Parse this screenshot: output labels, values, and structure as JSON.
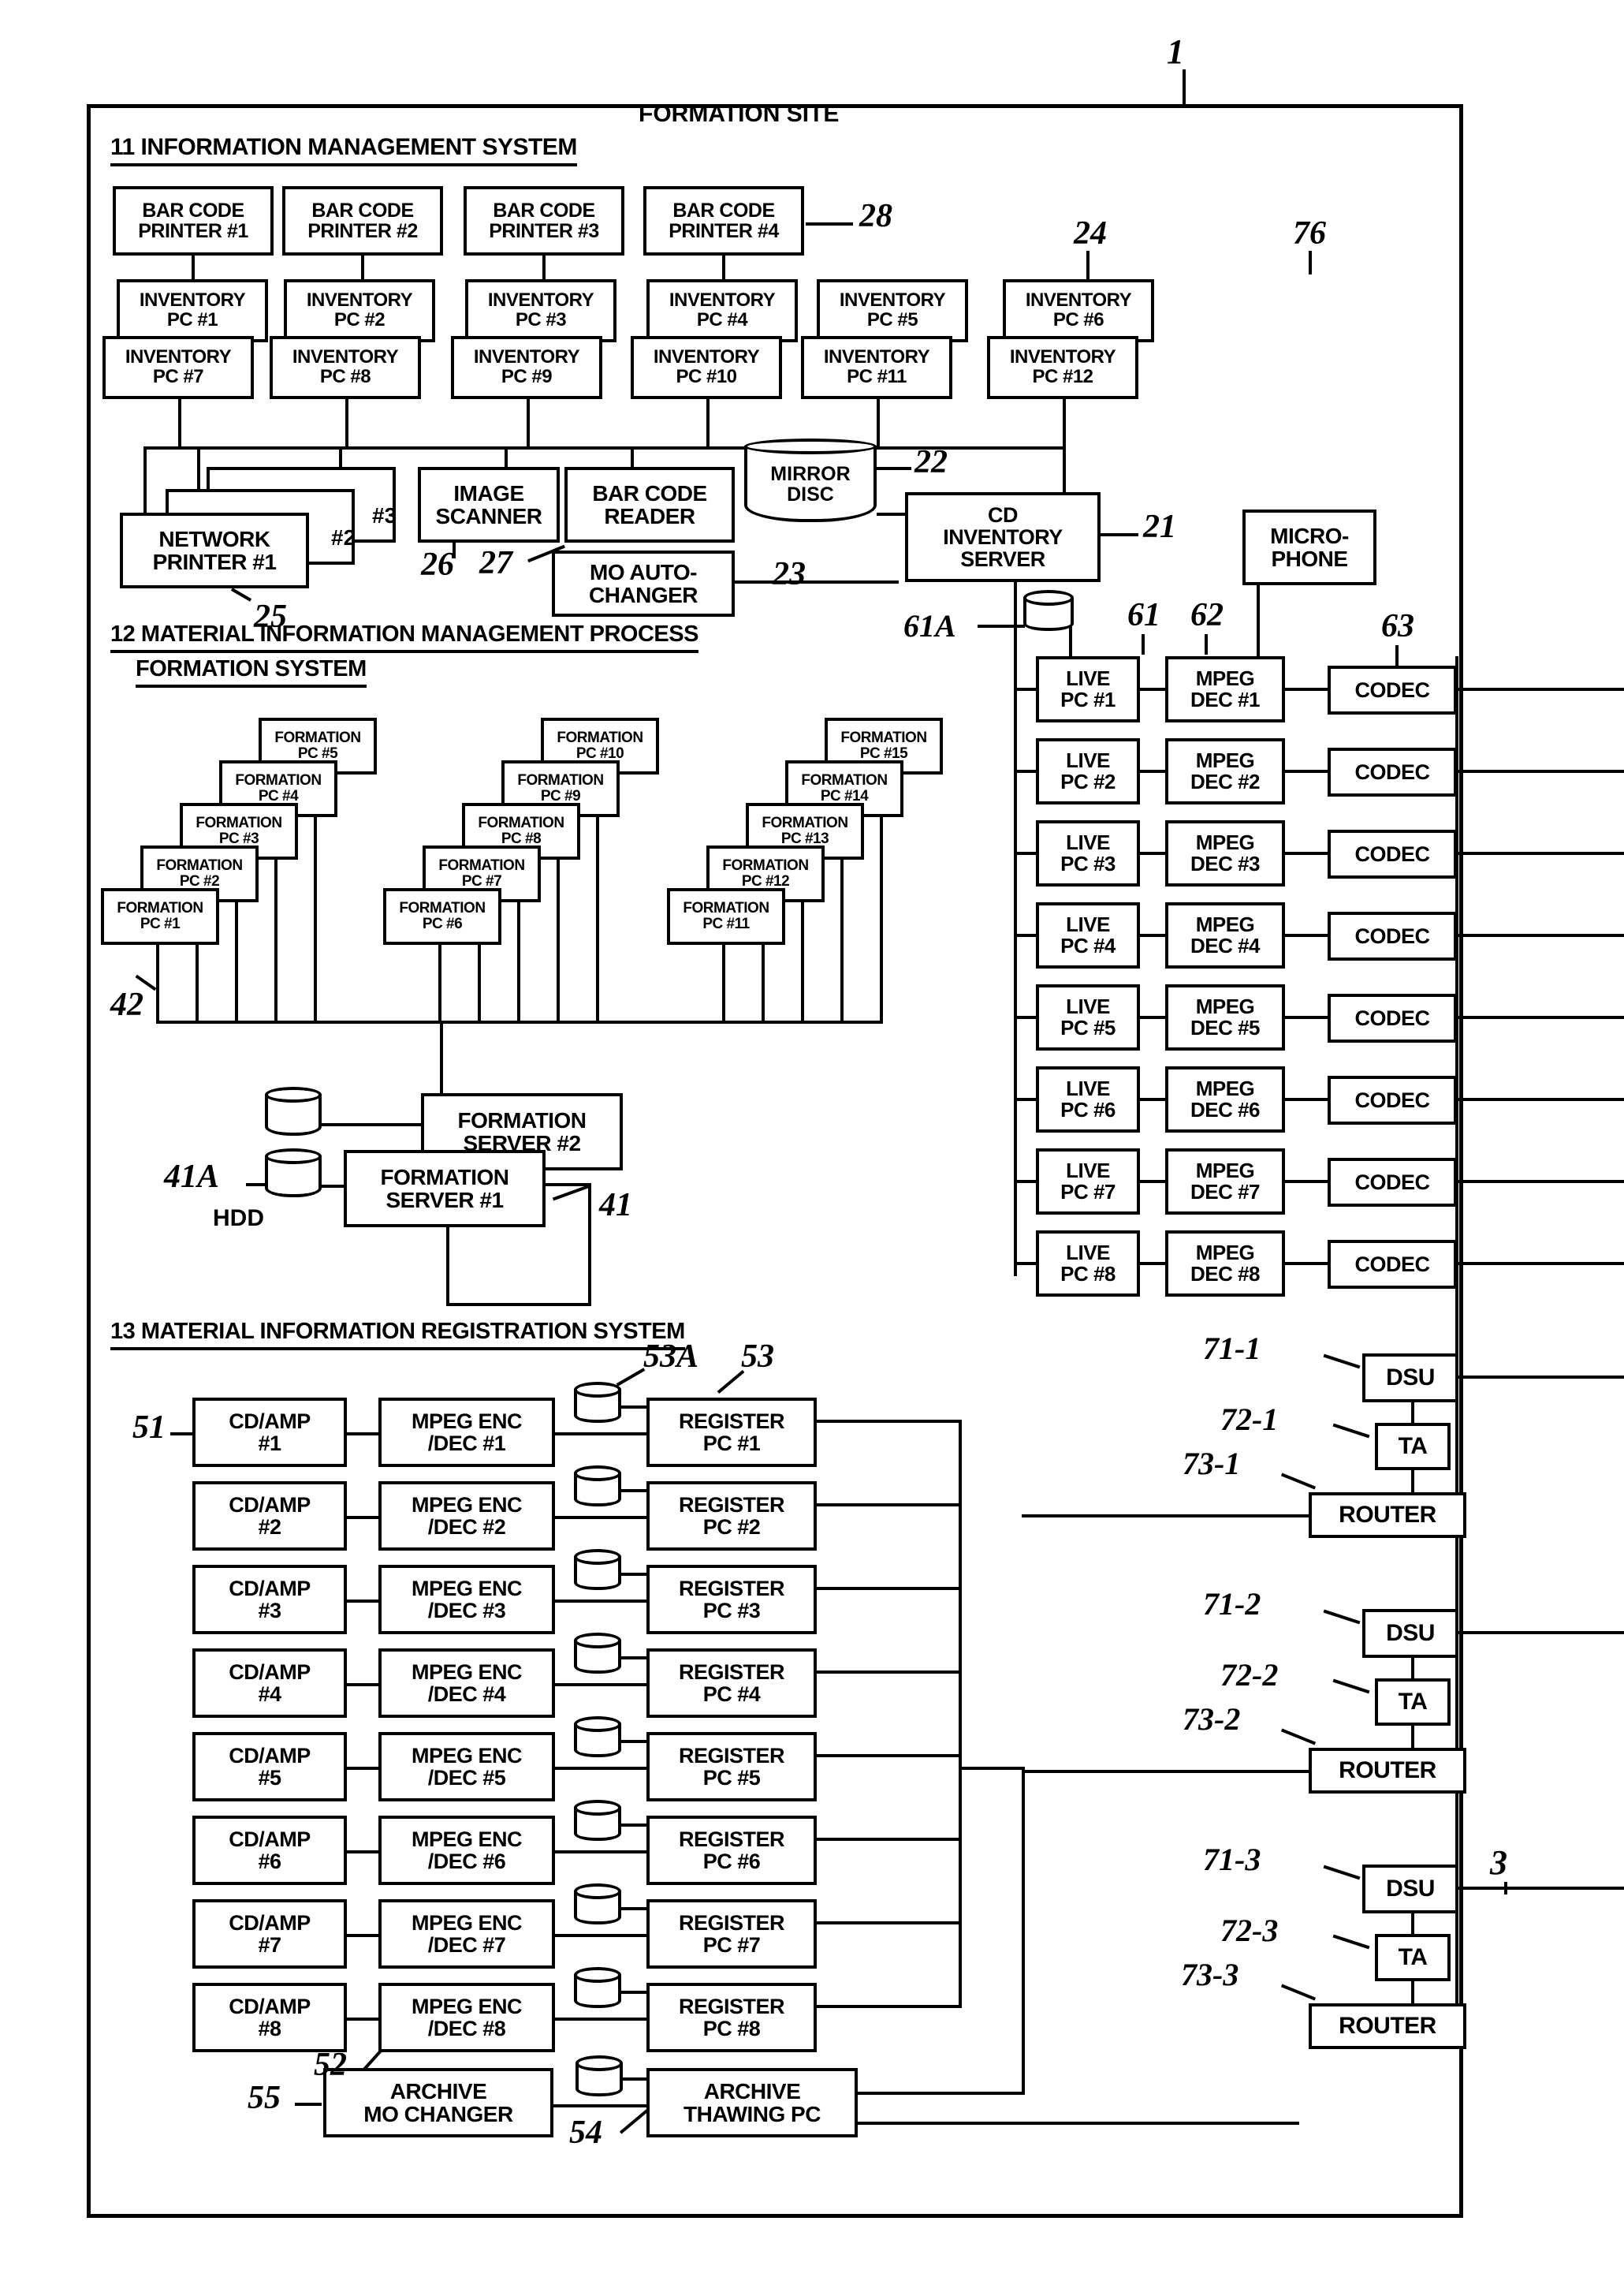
{
  "figure": {
    "site_title": "FORMATION SITE",
    "outer_ref": "1",
    "right_ref": "3"
  },
  "sections": {
    "s11": "11 INFORMATION MANAGEMENT SYSTEM",
    "s12_line1": "12 MATERIAL INFORMATION MANAGEMENT PROCESS",
    "s12_line2": "FORMATION SYSTEM",
    "s13": "13 MATERIAL INFORMATION REGISTRATION SYSTEM"
  },
  "bar_code_printers": [
    {
      "l1": "BAR CODE",
      "l2": "PRINTER #1"
    },
    {
      "l1": "BAR CODE",
      "l2": "PRINTER #2"
    },
    {
      "l1": "BAR CODE",
      "l2": "PRINTER #3"
    },
    {
      "l1": "BAR CODE",
      "l2": "PRINTER #4"
    }
  ],
  "inventory_pcs_top": [
    {
      "l1": "INVENTORY",
      "l2": "PC #1"
    },
    {
      "l1": "INVENTORY",
      "l2": "PC #2"
    },
    {
      "l1": "INVENTORY",
      "l2": "PC #3"
    },
    {
      "l1": "INVENTORY",
      "l2": "PC #4"
    },
    {
      "l1": "INVENTORY",
      "l2": "PC #5"
    },
    {
      "l1": "INVENTORY",
      "l2": "PC #6"
    }
  ],
  "inventory_pcs_bottom": [
    {
      "l1": "INVENTORY",
      "l2": "PC #7"
    },
    {
      "l1": "INVENTORY",
      "l2": "PC #8"
    },
    {
      "l1": "INVENTORY",
      "l2": "PC #9"
    },
    {
      "l1": "INVENTORY",
      "l2": "PC #10"
    },
    {
      "l1": "INVENTORY",
      "l2": "PC #11"
    },
    {
      "l1": "INVENTORY",
      "l2": "PC #12"
    }
  ],
  "network_printers": [
    {
      "l1": "NETWORK",
      "l2": "#3"
    },
    {
      "l1": "NETWORK",
      "l2": "#2"
    },
    {
      "l1": "NETWORK",
      "l2": "PRINTER #1"
    }
  ],
  "peripherals": {
    "image_scanner": {
      "l1": "IMAGE",
      "l2": "SCANNER"
    },
    "bar_code_reader": {
      "l1": "BAR CODE",
      "l2": "READER"
    },
    "mo_auto_changer": {
      "l1": "MO AUTO-",
      "l2": "CHANGER"
    },
    "mirror_disc": {
      "l1": "MIRROR",
      "l2": "DISC"
    },
    "cd_inventory_server": {
      "l1": "CD",
      "l2": "INVENTORY",
      "l3": "SERVER"
    },
    "microphone": {
      "l1": "MICRO-",
      "l2": "PHONE"
    }
  },
  "formation_pcs": [
    {
      "l1": "FORMATION",
      "l2": "PC #1"
    },
    {
      "l1": "FORMATION",
      "l2": "PC #2"
    },
    {
      "l1": "FORMATION",
      "l2": "PC #3"
    },
    {
      "l1": "FORMATION",
      "l2": "PC #4"
    },
    {
      "l1": "FORMATION",
      "l2": "PC #5"
    },
    {
      "l1": "FORMATION",
      "l2": "PC #6"
    },
    {
      "l1": "FORMATION",
      "l2": "PC #7"
    },
    {
      "l1": "FORMATION",
      "l2": "PC #8"
    },
    {
      "l1": "FORMATION",
      "l2": "PC #9"
    },
    {
      "l1": "FORMATION",
      "l2": "PC #10"
    },
    {
      "l1": "FORMATION",
      "l2": "PC #11"
    },
    {
      "l1": "FORMATION",
      "l2": "PC #12"
    },
    {
      "l1": "FORMATION",
      "l2": "PC #13"
    },
    {
      "l1": "FORMATION",
      "l2": "PC #14"
    },
    {
      "l1": "FORMATION",
      "l2": "PC #15"
    }
  ],
  "formation_servers": [
    {
      "l1": "FORMATION",
      "l2": "SERVER #2"
    },
    {
      "l1": "FORMATION",
      "l2": "SERVER #1"
    }
  ],
  "hdd_label": "HDD",
  "live_pcs": [
    {
      "l1": "LIVE",
      "l2": "PC #1"
    },
    {
      "l1": "LIVE",
      "l2": "PC #2"
    },
    {
      "l1": "LIVE",
      "l2": "PC #3"
    },
    {
      "l1": "LIVE",
      "l2": "PC #4"
    },
    {
      "l1": "LIVE",
      "l2": "PC #5"
    },
    {
      "l1": "LIVE",
      "l2": "PC #6"
    },
    {
      "l1": "LIVE",
      "l2": "PC #7"
    },
    {
      "l1": "LIVE",
      "l2": "PC #8"
    }
  ],
  "mpeg_decs": [
    {
      "l1": "MPEG",
      "l2": "DEC #1"
    },
    {
      "l1": "MPEG",
      "l2": "DEC #2"
    },
    {
      "l1": "MPEG",
      "l2": "DEC #3"
    },
    {
      "l1": "MPEG",
      "l2": "DEC #4"
    },
    {
      "l1": "MPEG",
      "l2": "DEC #5"
    },
    {
      "l1": "MPEG",
      "l2": "DEC #6"
    },
    {
      "l1": "MPEG",
      "l2": "DEC #7"
    },
    {
      "l1": "MPEG",
      "l2": "DEC #8"
    }
  ],
  "codecs": [
    "CODEC",
    "CODEC",
    "CODEC",
    "CODEC",
    "CODEC",
    "CODEC",
    "CODEC",
    "CODEC"
  ],
  "cd_amps": [
    {
      "l1": "CD/AMP",
      "l2": "#1"
    },
    {
      "l1": "CD/AMP",
      "l2": "#2"
    },
    {
      "l1": "CD/AMP",
      "l2": "#3"
    },
    {
      "l1": "CD/AMP",
      "l2": "#4"
    },
    {
      "l1": "CD/AMP",
      "l2": "#5"
    },
    {
      "l1": "CD/AMP",
      "l2": "#6"
    },
    {
      "l1": "CD/AMP",
      "l2": "#7"
    },
    {
      "l1": "CD/AMP",
      "l2": "#8"
    }
  ],
  "mpeg_encdecs": [
    {
      "l1": "MPEG ENC",
      "l2": "/DEC #1"
    },
    {
      "l1": "MPEG ENC",
      "l2": "/DEC #2"
    },
    {
      "l1": "MPEG ENC",
      "l2": "/DEC #3"
    },
    {
      "l1": "MPEG ENC",
      "l2": "/DEC #4"
    },
    {
      "l1": "MPEG ENC",
      "l2": "/DEC #5"
    },
    {
      "l1": "MPEG ENC",
      "l2": "/DEC #6"
    },
    {
      "l1": "MPEG ENC",
      "l2": "/DEC #7"
    },
    {
      "l1": "MPEG ENC",
      "l2": "/DEC #8"
    }
  ],
  "register_pcs": [
    {
      "l1": "REGISTER",
      "l2": "PC #1"
    },
    {
      "l1": "REGISTER",
      "l2": "PC #2"
    },
    {
      "l1": "REGISTER",
      "l2": "PC #3"
    },
    {
      "l1": "REGISTER",
      "l2": "PC #4"
    },
    {
      "l1": "REGISTER",
      "l2": "PC #5"
    },
    {
      "l1": "REGISTER",
      "l2": "PC #6"
    },
    {
      "l1": "REGISTER",
      "l2": "PC #7"
    },
    {
      "l1": "REGISTER",
      "l2": "PC #8"
    }
  ],
  "archive": {
    "mo_changer": {
      "l1": "ARCHIVE",
      "l2": "MO CHANGER"
    },
    "thawing_pc": {
      "l1": "ARCHIVE",
      "l2": "THAWING PC"
    }
  },
  "network_groups": [
    {
      "dsu": "DSU",
      "ta": "TA",
      "router": "ROUTER",
      "dsu_ref": "71-1",
      "ta_ref": "72-1",
      "router_ref": "73-1"
    },
    {
      "dsu": "DSU",
      "ta": "TA",
      "router": "ROUTER",
      "dsu_ref": "71-2",
      "ta_ref": "72-2",
      "router_ref": "73-2"
    },
    {
      "dsu": "DSU",
      "ta": "TA",
      "router": "ROUTER",
      "dsu_ref": "71-3",
      "ta_ref": "72-3",
      "router_ref": "73-3"
    }
  ],
  "refs": {
    "r28": "28",
    "r24": "24",
    "r22": "22",
    "r21": "21",
    "r23": "23",
    "r25": "25",
    "r26": "26",
    "r27": "27",
    "r61A": "61A",
    "r61": "61",
    "r62": "62",
    "r63": "63",
    "r76": "76",
    "r42": "42",
    "r41": "41",
    "r41A": "41A",
    "r51": "51",
    "r52": "52",
    "r53": "53",
    "r53A": "53A",
    "r54": "54",
    "r55": "55"
  }
}
